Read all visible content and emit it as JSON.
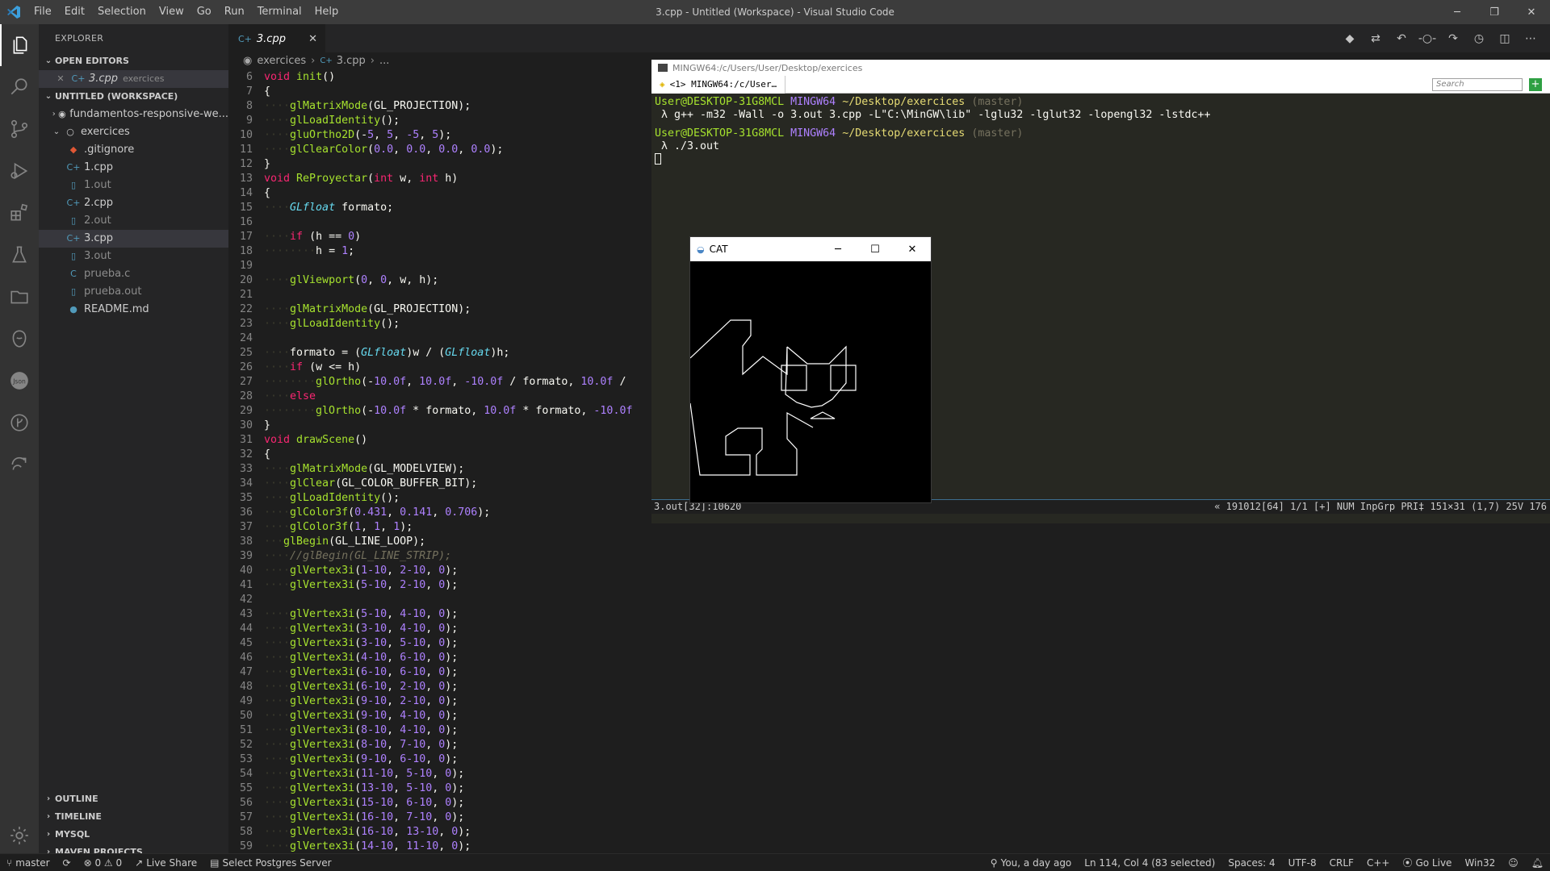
{
  "window": {
    "title": "3.cpp - Untitled (Workspace) - Visual Studio Code",
    "menu": [
      "File",
      "Edit",
      "Selection",
      "View",
      "Go",
      "Run",
      "Terminal",
      "Help"
    ]
  },
  "sidebar": {
    "header": "EXPLORER",
    "open_editors_label": "OPEN EDITORS",
    "open_editor": {
      "name": "3.cpp",
      "folder": "exercices"
    },
    "workspace_label": "UNTITLED (WORKSPACE)",
    "items": [
      {
        "label": "fundamentos-responsive-we...",
        "icon": "circle-icon",
        "level": 0,
        "chevron": "›"
      },
      {
        "label": "exercices",
        "icon": "circle-icon",
        "level": 0,
        "chevron": "⌄"
      },
      {
        "label": ".gitignore",
        "icon": "git-icon",
        "level": 1
      },
      {
        "label": "1.cpp",
        "icon": "cpp-icon",
        "level": 1
      },
      {
        "label": "1.out",
        "icon": "file-icon",
        "level": 1
      },
      {
        "label": "2.cpp",
        "icon": "cpp-icon",
        "level": 1
      },
      {
        "label": "2.out",
        "icon": "file-icon",
        "level": 1
      },
      {
        "label": "3.cpp",
        "icon": "cpp-icon",
        "level": 1
      },
      {
        "label": "3.out",
        "icon": "file-icon",
        "level": 1
      },
      {
        "label": "prueba.c",
        "icon": "c-icon",
        "level": 1
      },
      {
        "label": "prueba.out",
        "icon": "file-icon",
        "level": 1
      },
      {
        "label": "README.md",
        "icon": "info-icon",
        "level": 1
      }
    ],
    "bottom_sections": [
      "OUTLINE",
      "TIMELINE",
      "MYSQL",
      "MAVEN PROJECTS"
    ]
  },
  "editor": {
    "tab": "3.cpp",
    "breadcrumb": [
      "exercices",
      "3.cpp",
      "..."
    ],
    "code_lines": [
      {
        "n": 6,
        "t": "void init()"
      },
      {
        "n": 7,
        "t": "{"
      },
      {
        "n": 8,
        "t": "    glMatrixMode(GL_PROJECTION);"
      },
      {
        "n": 9,
        "t": "    glLoadIdentity();"
      },
      {
        "n": 10,
        "t": "    gluOrtho2D(-5, 5, -5, 5);"
      },
      {
        "n": 11,
        "t": "    glClearColor(0.0, 0.0, 0.0, 0.0);"
      },
      {
        "n": 12,
        "t": "}"
      },
      {
        "n": 13,
        "t": "void ReProyectar(int w, int h)"
      },
      {
        "n": 14,
        "t": "{"
      },
      {
        "n": 15,
        "t": "    GLfloat formato;"
      },
      {
        "n": 16,
        "t": ""
      },
      {
        "n": 17,
        "t": "    if (h == 0)"
      },
      {
        "n": 18,
        "t": "        h = 1;"
      },
      {
        "n": 19,
        "t": ""
      },
      {
        "n": 20,
        "t": "    glViewport(0, 0, w, h);"
      },
      {
        "n": 21,
        "t": ""
      },
      {
        "n": 22,
        "t": "    glMatrixMode(GL_PROJECTION);"
      },
      {
        "n": 23,
        "t": "    glLoadIdentity();"
      },
      {
        "n": 24,
        "t": ""
      },
      {
        "n": 25,
        "t": "    formato = (GLfloat)w / (GLfloat)h;"
      },
      {
        "n": 26,
        "t": "    if (w <= h)"
      },
      {
        "n": 27,
        "t": "        glOrtho(-10.0f, 10.0f, -10.0f / formato, 10.0f /"
      },
      {
        "n": 28,
        "t": "    else"
      },
      {
        "n": 29,
        "t": "        glOrtho(-10.0f * formato, 10.0f * formato, -10.0f"
      },
      {
        "n": 30,
        "t": "}"
      },
      {
        "n": 31,
        "t": "void drawScene()"
      },
      {
        "n": 32,
        "t": "{"
      },
      {
        "n": 33,
        "t": "    glMatrixMode(GL_MODELVIEW);"
      },
      {
        "n": 34,
        "t": "    glClear(GL_COLOR_BUFFER_BIT);"
      },
      {
        "n": 35,
        "t": "    glLoadIdentity();"
      },
      {
        "n": 36,
        "t": "    glColor3f(0.431, 0.141, 0.706);"
      },
      {
        "n": 37,
        "t": "    glColor3f(1, 1, 1);"
      },
      {
        "n": 38,
        "t": "   glBegin(GL_LINE_LOOP);"
      },
      {
        "n": 39,
        "t": "    //glBegin(GL_LINE_STRIP);"
      },
      {
        "n": 40,
        "t": "    glVertex3i(1-10, 2-10, 0);"
      },
      {
        "n": 41,
        "t": "    glVertex3i(5-10, 2-10, 0);"
      },
      {
        "n": 42,
        "t": ""
      },
      {
        "n": 43,
        "t": "    glVertex3i(5-10, 4-10, 0);"
      },
      {
        "n": 44,
        "t": "    glVertex3i(3-10, 4-10, 0);"
      },
      {
        "n": 45,
        "t": "    glVertex3i(3-10, 5-10, 0);"
      },
      {
        "n": 46,
        "t": "    glVertex3i(4-10, 6-10, 0);"
      },
      {
        "n": 47,
        "t": "    glVertex3i(6-10, 6-10, 0);"
      },
      {
        "n": 48,
        "t": "    glVertex3i(6-10, 2-10, 0);"
      },
      {
        "n": 49,
        "t": "    glVertex3i(9-10, 2-10, 0);"
      },
      {
        "n": 50,
        "t": "    glVertex3i(9-10, 4-10, 0);"
      },
      {
        "n": 51,
        "t": "    glVertex3i(8-10, 4-10, 0);"
      },
      {
        "n": 52,
        "t": "    glVertex3i(8-10, 7-10, 0);"
      },
      {
        "n": 53,
        "t": "    glVertex3i(9-10, 6-10, 0);"
      },
      {
        "n": 54,
        "t": "    glVertex3i(11-10, 5-10, 0);"
      },
      {
        "n": 55,
        "t": "    glVertex3i(13-10, 5-10, 0);"
      },
      {
        "n": 56,
        "t": "    glVertex3i(15-10, 6-10, 0);"
      },
      {
        "n": 57,
        "t": "    glVertex3i(16-10, 7-10, 0);"
      },
      {
        "n": 58,
        "t": "    glVertex3i(16-10, 13-10, 0);"
      },
      {
        "n": 59,
        "t": "    glVertex3i(14-10, 11-10, 0);"
      }
    ]
  },
  "terminal": {
    "title": "MINGW64:/c/Users/User/Desktop/exercices",
    "tab_label": "<1> MINGW64:/c/User…",
    "search_placeholder": "Search",
    "lines": [
      {
        "user": "User@DESKTOP-31G8MCL",
        "shell": "MINGW64",
        "path": "~/Desktop/exercices",
        "branch": "(master)"
      },
      {
        "cmd": " λ g++ -m32 -Wall -o 3.out 3.cpp -L\"C:\\MinGW\\lib\" -lglu32 -lglut32 -lopengl32 -lstdc++"
      },
      {
        "user": "User@DESKTOP-31G8MCL",
        "shell": "MINGW64",
        "path": "~/Desktop/exercices",
        "branch": "(master)"
      },
      {
        "cmd": " λ ./3.out"
      }
    ],
    "status_left": "3.out[32]:10620",
    "status_right": "« 191012[64]  1/1  [+] NUM InpGrp PRI‡ 151×31    (1,7) 25V    176"
  },
  "cat_window": {
    "title": "CAT",
    "line_color": "#ffffff",
    "background": "#000000"
  },
  "statusbar": {
    "branch": "master",
    "problems": "⊗ 0 ⚠ 0",
    "live_share": "Live Share",
    "postgres": "Select Postgres Server",
    "blame": "You, a day ago",
    "position": "Ln 114, Col 4 (83 selected)",
    "spaces": "Spaces: 4",
    "encoding": "UTF-8",
    "eol": "CRLF",
    "language": "C++",
    "go_live": "Go Live",
    "platform": "Win32"
  },
  "colors": {
    "accent": "#007acc",
    "titlebar": "#3c3c3c",
    "sidebar": "#252526",
    "editor": "#1e1e1e"
  }
}
